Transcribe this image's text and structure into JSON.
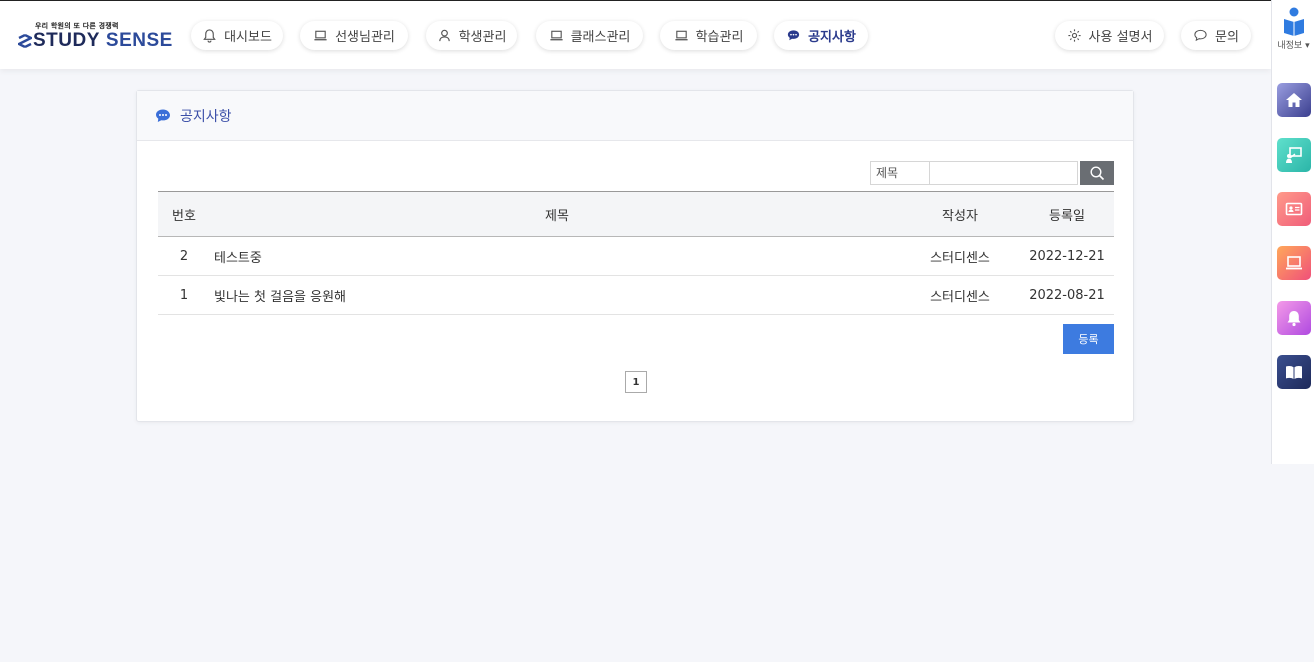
{
  "brand": {
    "tagline": "우리 학원의 또 다른 경쟁력",
    "name_part1": "STUDY",
    "name_part2": "SENSE"
  },
  "nav": {
    "items": [
      {
        "label": "대시보드",
        "icon": "bell-icon",
        "active": false
      },
      {
        "label": "선생님관리",
        "icon": "laptop-icon",
        "active": false
      },
      {
        "label": "학생관리",
        "icon": "person-icon",
        "active": false
      },
      {
        "label": "클래스관리",
        "icon": "laptop-icon",
        "active": false
      },
      {
        "label": "학습관리",
        "icon": "laptop-icon",
        "active": false
      },
      {
        "label": "공지사항",
        "icon": "chat-bubble-icon",
        "active": true
      }
    ],
    "manual_label": "사용 설명서",
    "inquiry_label": "문의"
  },
  "rail": {
    "my_info_label": "내정보",
    "buttons": [
      {
        "name": "home",
        "icon": "home-icon",
        "color_from": "#8b8fd6",
        "color_to": "#3b3f8f"
      },
      {
        "name": "teacher",
        "icon": "presentation-icon",
        "color_from": "#4fd3c4",
        "color_to": "#2bb5a8"
      },
      {
        "name": "student",
        "icon": "id-card-icon",
        "color_from": "#ff8a8a",
        "color_to": "#f05d7a"
      },
      {
        "name": "class",
        "icon": "laptop-icon",
        "color_from": "#ff9a5a",
        "color_to": "#f0507a"
      },
      {
        "name": "notice",
        "icon": "bell-icon",
        "color_from": "#f08ae0",
        "color_to": "#b04ae0"
      },
      {
        "name": "manual",
        "icon": "book-icon",
        "color_from": "#3b4f8f",
        "color_to": "#1e2a5a"
      }
    ]
  },
  "page": {
    "title": "공지사항",
    "search": {
      "field_label": "제목",
      "value": ""
    },
    "table": {
      "headers": {
        "no": "번호",
        "title": "제목",
        "author": "작성자",
        "date": "등록일"
      },
      "rows": [
        {
          "no": "2",
          "title": "테스트중",
          "author": "스터디센스",
          "date": "2022-12-21"
        },
        {
          "no": "1",
          "title": "빛나는 첫 걸음을 응원해",
          "author": "스터디센스",
          "date": "2022-08-21"
        }
      ]
    },
    "register_label": "등록",
    "pagination": {
      "current": "1"
    }
  },
  "colors": {
    "accent": "#3b4fa8",
    "register_button": "#3d7be0",
    "search_button": "#6a6e73"
  }
}
